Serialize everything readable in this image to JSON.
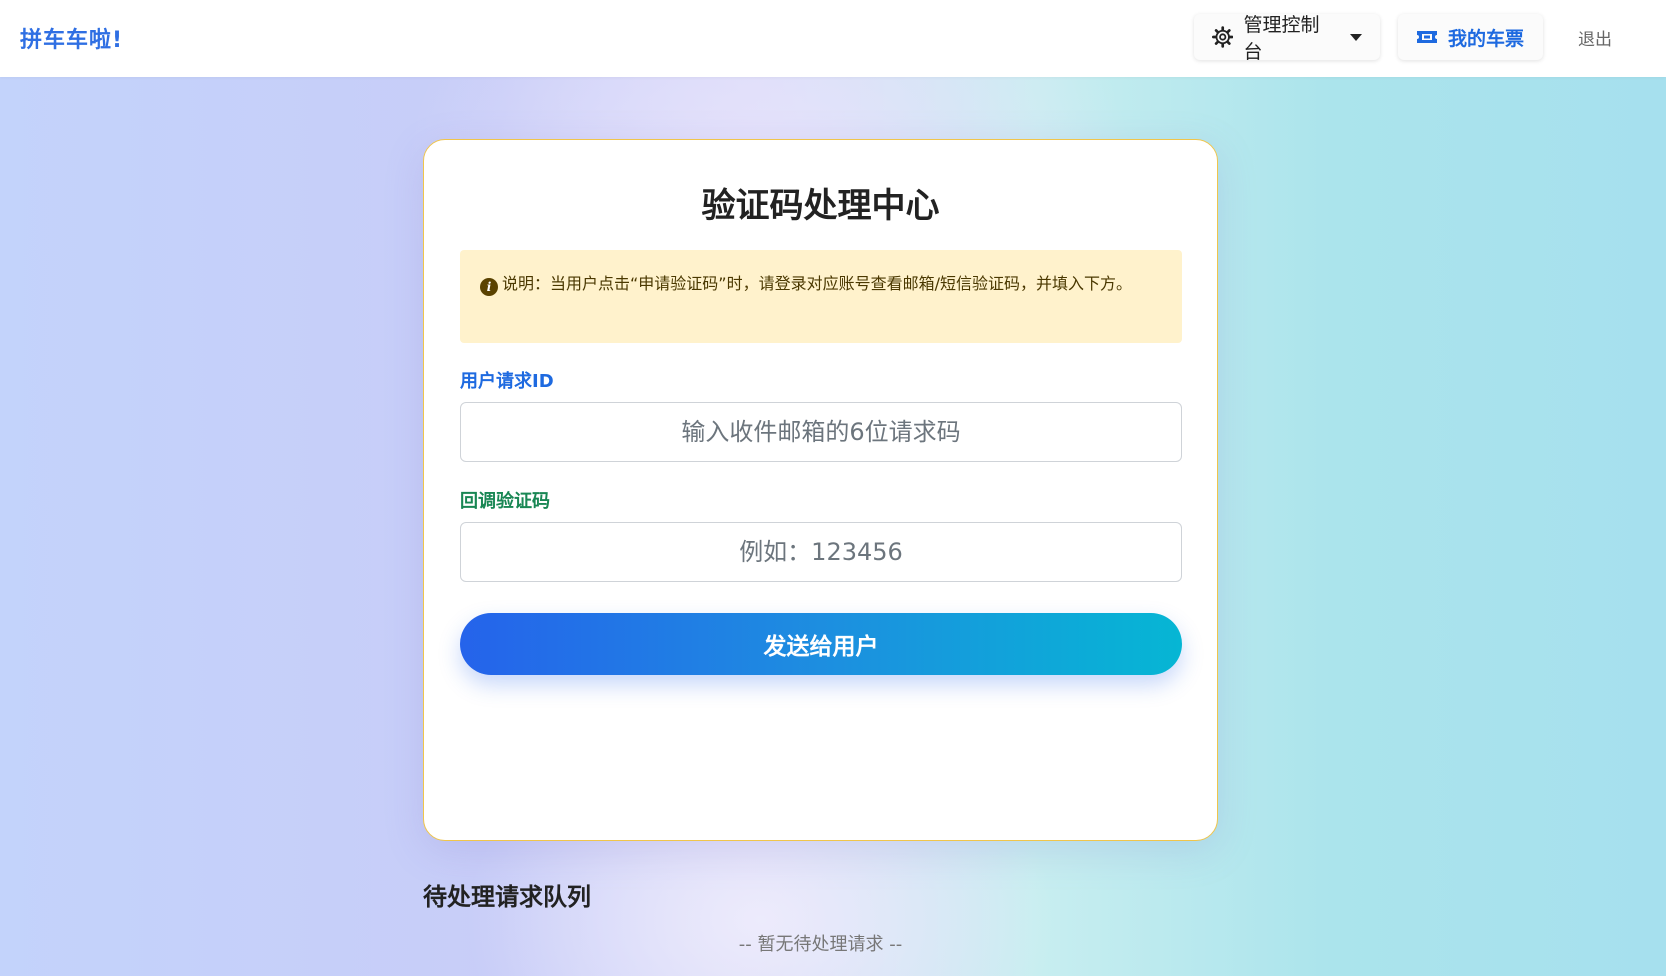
{
  "navbar": {
    "brand": "拼车车啦!",
    "console_label": "管理控制台",
    "tickets_label": "我的车票",
    "logout_label": "退出"
  },
  "card": {
    "title": "验证码处理中心",
    "alert_text": "说明：当用户点击“申请验证码”时，请登录对应账号查看邮箱/短信验证码，并填入下方。",
    "request_id_label": "用户请求ID",
    "request_id_value": "",
    "request_id_placeholder": "输入收件邮箱的6位请求码",
    "code_label": "回调验证码",
    "code_value": "",
    "code_placeholder": "例如：123456",
    "send_button": "发送给用户"
  },
  "queue": {
    "title": "待处理请求队列",
    "empty_text": "-- 暂无待处理请求 --"
  },
  "colors": {
    "brand": "#2f6fe3",
    "primary": "#1e6ae0",
    "success": "#198754",
    "alert_bg": "#fff2cc",
    "card_border": "#f0c54b"
  }
}
